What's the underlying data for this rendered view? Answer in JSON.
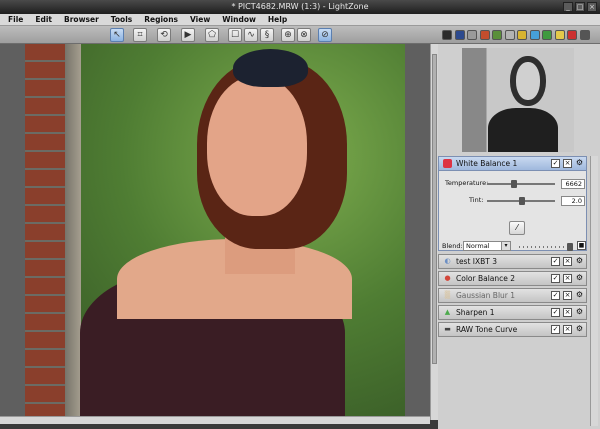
{
  "window": {
    "title": "* PICT4682.MRW (1:3) - LightZone",
    "buttons": [
      "_",
      "□",
      "×"
    ]
  },
  "menu": [
    "File",
    "Edit",
    "Browser",
    "Tools",
    "Regions",
    "View",
    "Window",
    "Help"
  ],
  "toolbar": {
    "tools": [
      {
        "name": "select",
        "glyph": "↖"
      },
      {
        "name": "crop",
        "glyph": "⌗"
      },
      {
        "name": "rotate",
        "glyph": "⟲"
      },
      {
        "name": "send",
        "glyph": "▶"
      },
      {
        "name": "region-polygon",
        "glyph": "⬠"
      },
      {
        "name": "region-spline",
        "glyph": "☐"
      },
      {
        "name": "region-bezier",
        "glyph": "∿"
      },
      {
        "name": "region-curve",
        "glyph": "§"
      },
      {
        "name": "clone",
        "glyph": "⊕"
      },
      {
        "name": "stamp",
        "glyph": "⊗"
      },
      {
        "name": "eyedropper",
        "glyph": "⊘"
      }
    ],
    "swatch_colors": [
      "#2b2b2b",
      "#2d4a8e",
      "#9a9a9a",
      "#c24d2d",
      "#5a8f3a",
      "#b3b3b3",
      "#d8b431",
      "#46a0d8",
      "#3f9a3f",
      "#e3c84a",
      "#cc3030",
      "#555555"
    ]
  },
  "right_panel": {
    "white_balance": {
      "title": "White Balance 1",
      "temperature_label": "Temperature:",
      "temperature_value": "6662",
      "tint_label": "Tint:",
      "tint_value": "2.0",
      "blend_label": "Blend:",
      "blend_mode": "Normal",
      "temperature_level": 0.38,
      "tint_level": 0.52,
      "opacity_level": 1.0
    },
    "tools": [
      {
        "label": "test IXBT 3",
        "icon": "◐",
        "dim": false,
        "color": "#6c8fc4"
      },
      {
        "label": "Color Balance 2",
        "icon": "●",
        "dim": false,
        "color": "#d3463a"
      },
      {
        "label": "Gaussian Blur 1",
        "icon": "▒",
        "dim": true,
        "color": "#d9c29a"
      },
      {
        "label": "Sharpen 1",
        "icon": "▲",
        "dim": false,
        "color": "#4caa4c"
      },
      {
        "label": "RAW Tone Curve",
        "icon": "▬",
        "dim": false,
        "color": "#444444"
      }
    ]
  }
}
